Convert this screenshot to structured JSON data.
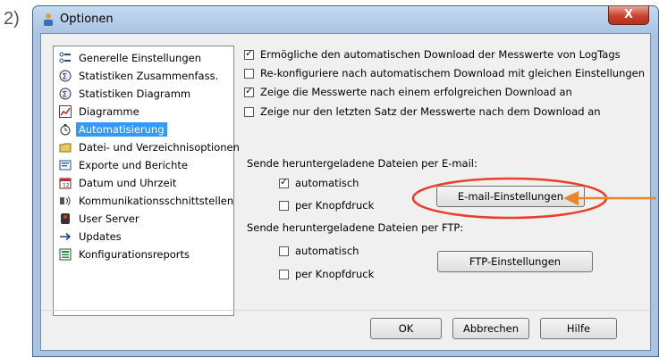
{
  "step_label": "2)",
  "window": {
    "title": "Optionen",
    "close_symbol": "X"
  },
  "nav": {
    "items": [
      {
        "label": "Generelle Einstellungen",
        "icon": "settings-list-icon"
      },
      {
        "label": "Statistiken Zusammenfass.",
        "icon": "statistics-icon"
      },
      {
        "label": "Statistiken Diagramm",
        "icon": "statistics-chart-icon"
      },
      {
        "label": "Diagramme",
        "icon": "chart-icon"
      },
      {
        "label": "Automatisierung",
        "icon": "automation-icon",
        "selected": true
      },
      {
        "label": "Datei- und Verzeichnisoptionen",
        "icon": "folder-icon"
      },
      {
        "label": "Exporte und Berichte",
        "icon": "report-icon"
      },
      {
        "label": "Datum und Uhrzeit",
        "icon": "calendar-icon"
      },
      {
        "label": "Kommunikationsschnittstellen",
        "icon": "interface-icon"
      },
      {
        "label": "User Server",
        "icon": "server-icon"
      },
      {
        "label": "Updates",
        "icon": "arrow-right-icon"
      },
      {
        "label": "Konfigurationsreports",
        "icon": "config-report-icon"
      }
    ]
  },
  "options": {
    "auto_download": {
      "label": "Ermögliche den automatischen Download der Messwerte von LogTags",
      "checked": true
    },
    "reconfigure": {
      "label": "Re-konfiguriere nach automatischem Download mit gleichen Einstellungen",
      "checked": false
    },
    "show_values": {
      "label": "Zeige die Messwerte nach einem erfolgreichen Download an",
      "checked": true
    },
    "show_last": {
      "label": "Zeige nur den letzten Satz der Messwerte nach dem Download an",
      "checked": false
    }
  },
  "email": {
    "section_label": "Sende heruntergeladene Dateien per E-mail:",
    "automatic": {
      "label": "automatisch",
      "checked": true
    },
    "button_press": {
      "label": "per Knopfdruck",
      "checked": false
    },
    "settings_button": "E-mail-Einstellungen"
  },
  "ftp": {
    "section_label": "Sende heruntergeladene Dateien per FTP:",
    "automatic": {
      "label": "automatisch",
      "checked": false
    },
    "button_press": {
      "label": "per Knopfdruck",
      "checked": false
    },
    "settings_button": "FTP-Einstellungen"
  },
  "footer": {
    "ok": "OK",
    "cancel": "Abbrechen",
    "help": "Hilfe"
  },
  "annotation": {
    "circle_color": "#e8402a",
    "arrow_color": "#e8842a"
  }
}
